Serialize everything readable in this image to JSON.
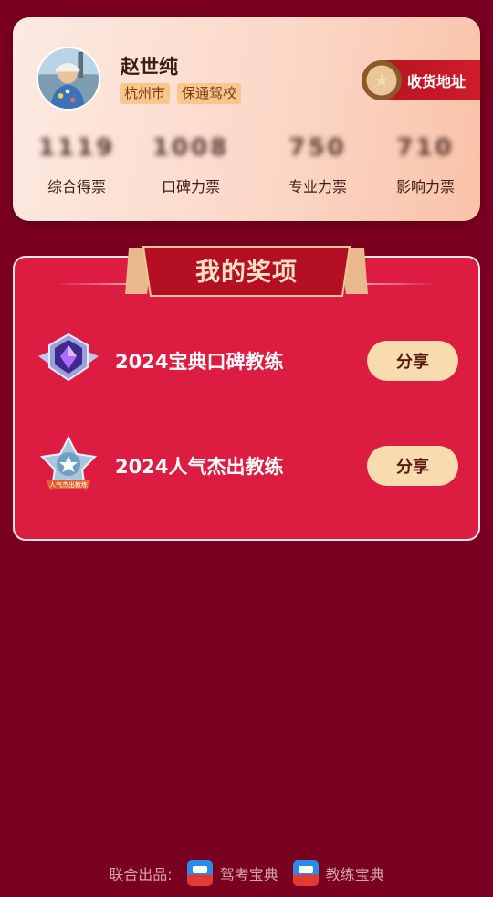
{
  "profile": {
    "name": "赵世纯",
    "tags": [
      "杭州市",
      "保通驾校"
    ],
    "address_button": "收货地址",
    "stats": [
      {
        "value": "1119",
        "label": "综合得票"
      },
      {
        "value": "1008",
        "label": "口碑力票"
      },
      {
        "value": "750",
        "label": "专业力票"
      },
      {
        "value": "710",
        "label": "影响力票"
      }
    ]
  },
  "awards": {
    "title": "我的奖项",
    "items": [
      {
        "name": "2024宝典口碑教练",
        "share": "分享",
        "icon": "purple-gem-badge-icon"
      },
      {
        "name": "2024人气杰出教练",
        "share": "分享",
        "icon": "star-medal-icon",
        "badge_text": "人气杰出教练"
      }
    ]
  },
  "footer": {
    "prefix": "联合出品:",
    "apps": [
      "驾考宝典",
      "教练宝典"
    ]
  },
  "colors": {
    "background": "#790020",
    "panel": "#dd1c42",
    "share_button": "#f8dbae"
  }
}
